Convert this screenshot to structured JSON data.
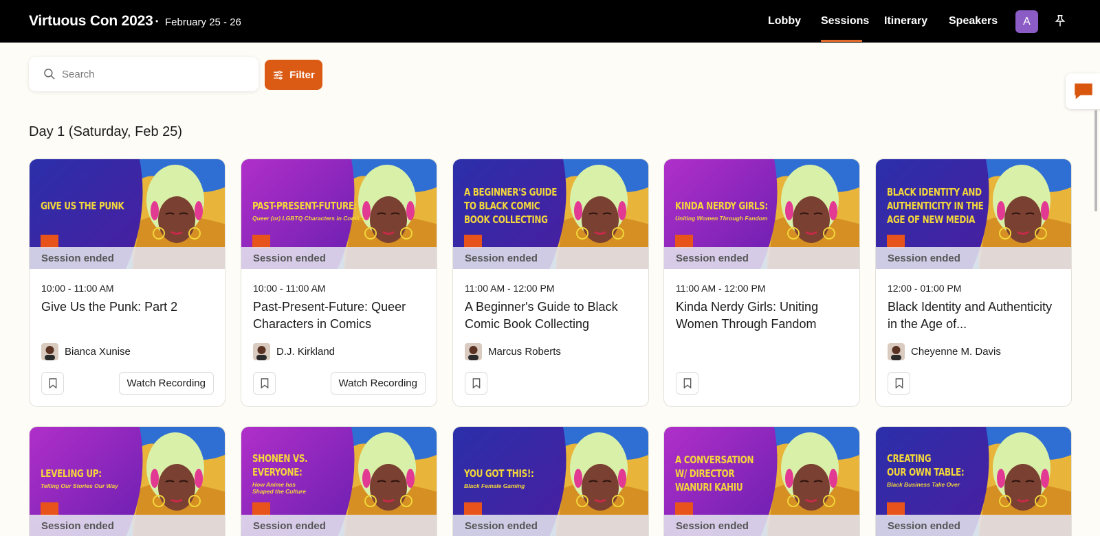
{
  "header": {
    "title": "Virtuous Con 2023",
    "separator": "•",
    "dates": "February 25 - 26",
    "nav": [
      "Lobby",
      "Sessions",
      "Itinerary",
      "Speakers"
    ],
    "active_nav": "Sessions",
    "avatar_letter": "A",
    "accent": "#e06a2a"
  },
  "search": {
    "placeholder": "Search"
  },
  "filter": {
    "label": "Filter"
  },
  "day": {
    "heading": "Day 1 (Saturday, Feb 25)"
  },
  "colors": {
    "filter_bg": "#db5a14",
    "avatar_bg": "#8c5cc6",
    "poster_title": "#f2d63b"
  },
  "sessions": [
    {
      "poster_title": "GIVE US THE PUNK",
      "poster_sub": "",
      "status": "Session ended",
      "time": "10:00 - 11:00 AM",
      "title": "Give Us the Punk: Part 2",
      "speaker": "Bianca Xunise",
      "action": "Watch Recording",
      "bg": "blue"
    },
    {
      "poster_title": "PAST-PRESENT-FUTURE:",
      "poster_sub": "Queer (or) LGBTQ Characters in Comics",
      "status": "Session ended",
      "time": "10:00 - 11:00 AM",
      "title": "Past-Present-Future: Queer Characters in Comics",
      "speaker": "D.J. Kirkland",
      "action": "Watch Recording",
      "bg": "purple"
    },
    {
      "poster_title": "A BEGINNER'S GUIDE\nTO BLACK COMIC\nBOOK COLLECTING",
      "poster_sub": "",
      "status": "Session ended",
      "time": "11:00 AM - 12:00 PM",
      "title": "A Beginner's Guide to Black Comic Book Collecting",
      "speaker": "Marcus Roberts",
      "action": "",
      "bg": "blue"
    },
    {
      "poster_title": "KINDA NERDY GIRLS:",
      "poster_sub": "Uniting Women Through Fandom",
      "status": "Session ended",
      "time": "11:00 AM - 12:00 PM",
      "title": "Kinda Nerdy Girls: Uniting Women Through Fandom",
      "speaker": "",
      "action": "",
      "bg": "purple"
    },
    {
      "poster_title": "BLACK IDENTITY AND\nAUTHENTICITY IN THE\nAGE OF NEW MEDIA",
      "poster_sub": "",
      "status": "Session ended",
      "time": "12:00 - 01:00 PM",
      "title": "Black Identity and Authenticity in the Age of...",
      "speaker": "Cheyenne M. Davis",
      "action": "",
      "bg": "blue"
    },
    {
      "poster_title": "LEVELING UP:",
      "poster_sub": "Telling Our Stories Our Way",
      "status": "Session ended",
      "time": "",
      "title": "",
      "speaker": "",
      "action": "",
      "bg": "purple"
    },
    {
      "poster_title": "SHONEN VS.\nEVERYONE:",
      "poster_sub": "How Anime has\nShaped the Culture",
      "status": "Session ended",
      "time": "",
      "title": "",
      "speaker": "",
      "action": "",
      "bg": "purple"
    },
    {
      "poster_title": "YOU GOT THIS!:",
      "poster_sub": "Black Female Gaming",
      "status": "Session ended",
      "time": "",
      "title": "",
      "speaker": "",
      "action": "",
      "bg": "blue"
    },
    {
      "poster_title": "A CONVERSATION\nW/ DIRECTOR\nWANURI KAHIU",
      "poster_sub": "",
      "status": "Session ended",
      "time": "",
      "title": "",
      "speaker": "",
      "action": "",
      "bg": "purple"
    },
    {
      "poster_title": "CREATING\nOUR OWN TABLE:",
      "poster_sub": "Black Business Take Over",
      "status": "Session ended",
      "time": "",
      "title": "",
      "speaker": "",
      "action": "",
      "bg": "blue"
    }
  ]
}
